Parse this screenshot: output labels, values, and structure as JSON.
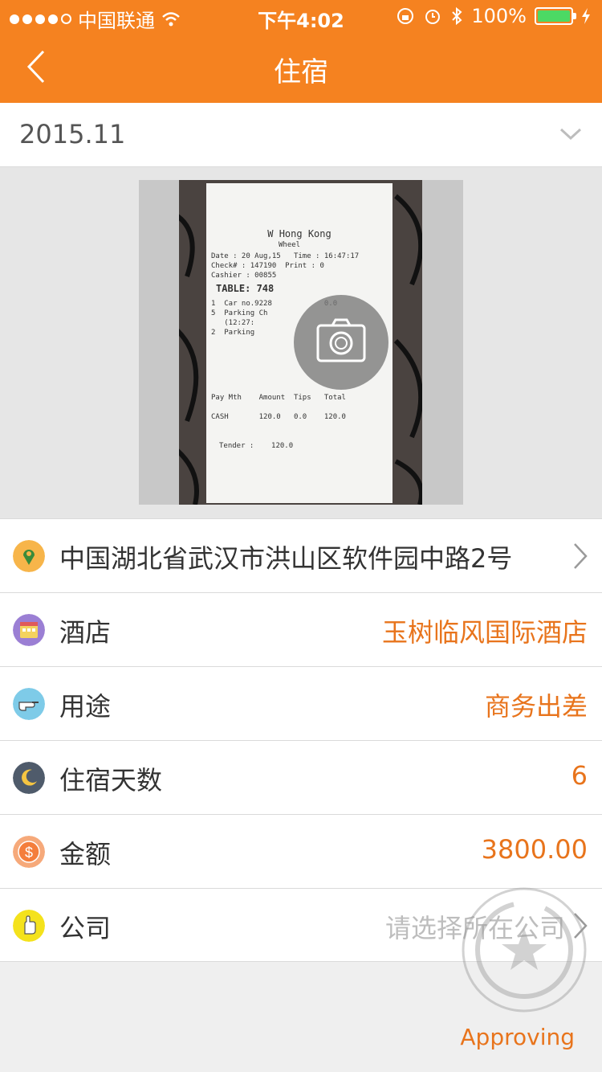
{
  "status_bar": {
    "carrier": "中国联通",
    "time": "下午4:02",
    "battery": "100%"
  },
  "navbar": {
    "title": "住宿"
  },
  "period": {
    "value": "2015.11"
  },
  "receipt": {
    "header": "W Hong Kong",
    "lines": [
      "Wheel",
      "Date : 20 Aug,15   Time : 16:47:17",
      "Check# : 147190  Print : 0",
      "Cashier : 00855",
      "TABLE: 748",
      "1  Car no.9228            0.0",
      "5  Parking Ch",
      "   (12:27:",
      "2  Parking",
      "Pay Mth    Amount  Tips   Total",
      "CASH       120.0   0.0    120.0",
      "Tender :    120.0"
    ]
  },
  "rows": [
    {
      "icon": "location-pin-icon",
      "label": "中国湖北省武汉市洪山区软件园中路2号",
      "value": ""
    },
    {
      "icon": "hotel-icon",
      "label": "酒店",
      "value": "玉树临风国际酒店"
    },
    {
      "icon": "pointing-hand-icon",
      "label": "用途",
      "value": "商务出差"
    },
    {
      "icon": "moon-icon",
      "label": "住宿天数",
      "value": "6"
    },
    {
      "icon": "dollar-coin-icon",
      "label": "金额",
      "value": "3800.00"
    },
    {
      "icon": "hand-icon",
      "label": "公司",
      "value": "请选择所在公司"
    }
  ],
  "footer": {
    "status": "Approving"
  },
  "colors": {
    "brand": "#f58220",
    "accent_text": "#e8741c",
    "placeholder": "#bdbdbd"
  }
}
